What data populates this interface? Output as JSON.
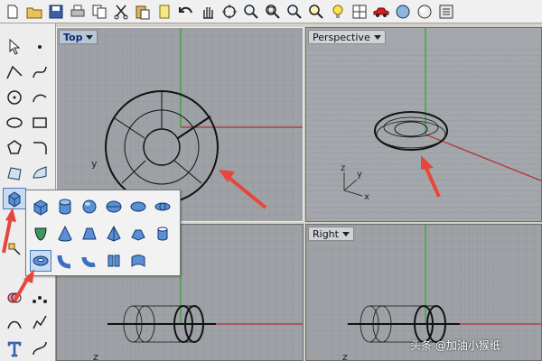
{
  "toolbar": {
    "items": [
      {
        "icon": "new-file-icon"
      },
      {
        "icon": "open-folder-icon"
      },
      {
        "icon": "save-icon"
      },
      {
        "icon": "print-icon"
      },
      {
        "icon": "copy-icon"
      },
      {
        "icon": "cut-icon"
      },
      {
        "icon": "paste-icon"
      },
      {
        "icon": "clipboard-icon"
      },
      {
        "icon": "undo-icon"
      },
      {
        "icon": "pan-hand-icon"
      },
      {
        "icon": "rotate-view-icon"
      },
      {
        "icon": "zoom-icon"
      },
      {
        "icon": "zoom-window-icon"
      },
      {
        "icon": "zoom-extents-icon"
      },
      {
        "icon": "zoom-selected-icon"
      },
      {
        "icon": "lightbulb-icon"
      },
      {
        "icon": "grid-layout-icon"
      },
      {
        "icon": "car-icon"
      },
      {
        "icon": "render-sphere-icon"
      },
      {
        "icon": "material-icon"
      },
      {
        "icon": "options-icon"
      }
    ]
  },
  "viewports": {
    "top": {
      "title": "Top",
      "axis_y": "y"
    },
    "perspective": {
      "title": "Perspective",
      "axis_z": "z",
      "axis_y": "y",
      "axis_x": "x"
    },
    "front": {
      "title": "",
      "axis_z": "z"
    },
    "right": {
      "title": "Right",
      "axis_z": "z"
    }
  },
  "flyout": {
    "rows": [
      [
        "box-icon",
        "cylinder-icon",
        "sphere-icon",
        "ellipsoid-icon",
        "ellipsoid-flat-icon",
        "ellipsoid-wire-icon"
      ],
      [
        "paraboloid-icon",
        "cone-icon",
        "truncated-cone-icon",
        "pyramid-icon",
        "truncated-pyramid-icon",
        "tube-icon"
      ],
      [
        "torus-icon",
        "pipe-icon",
        "pipe-variable-icon",
        "extrude-icon",
        "extrude-surface-icon"
      ]
    ]
  },
  "watermark": "头条 @加油小猴纸",
  "colors": {
    "x_axis": "#b03030",
    "y_axis": "#2ea52e",
    "grid": "#8a8e93",
    "arrow": "#e8463a"
  }
}
